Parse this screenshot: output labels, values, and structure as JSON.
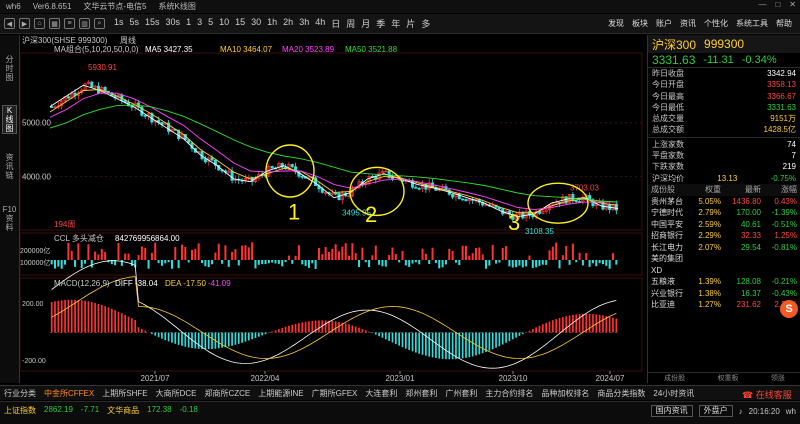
{
  "titlebar": {
    "app": "wh6",
    "version": "Ver6.8.651",
    "server": "文华云节点-电信5",
    "view": "系统K线图",
    "controls": [
      "—",
      "□",
      "✕"
    ]
  },
  "toolbar": {
    "periods": [
      "1s",
      "5s",
      "15s",
      "30s",
      "1",
      "3",
      "5",
      "10",
      "15",
      "30",
      "1h",
      "2h",
      "3h",
      "4h",
      "日",
      "周",
      "月",
      "季",
      "年",
      "片",
      "多"
    ],
    "right": [
      "发现",
      "板块",
      "账户",
      "资讯",
      "个性化",
      "系统工具",
      "帮助"
    ]
  },
  "left_tabs": [
    {
      "label": "分时图",
      "active": false
    },
    {
      "label": "K线图",
      "active": true
    },
    {
      "label": "资讯链",
      "active": false
    },
    {
      "label": "F10资料",
      "active": false
    }
  ],
  "chart_header": {
    "symbol": "沪深300(SHSE 999300)",
    "period": "周线",
    "ma_label": "MA组合(5,10,20,50,0,0)",
    "ma5": "MA5 3427.35",
    "ma10": "MA10 3464.07",
    "ma20": "MA20 3523.89",
    "ma50": "MA50 3521.88"
  },
  "chart_data": [
    {
      "type": "candlestick",
      "title": "沪深300(SHSE 999300) 周线",
      "x_ticks": [
        "2021/07",
        "2022/04",
        "2023/01",
        "2023/10",
        "2024/07"
      ],
      "y_ticks": [
        "5000.00",
        "4000.00"
      ],
      "ylim": [
        3000,
        6300
      ],
      "annotations": {
        "high_label": "5930.91",
        "low_label_1": "3495.95",
        "low_label_2": "3108.35",
        "recent_high_label": "3703.03",
        "count_label": "194周",
        "handwritten": [
          "1",
          "2",
          "3"
        ]
      },
      "series": [
        {
          "name": "MA5",
          "values": [
            5300,
            5500,
            5700,
            5600,
            5450,
            5300,
            5100,
            4900,
            4700,
            4400,
            4200,
            3950,
            3900,
            4100,
            4200,
            4050,
            3850,
            3600,
            3700,
            3950,
            4050,
            3950,
            3850,
            3780,
            3700,
            3600,
            3500,
            3350,
            3250,
            3300,
            3500,
            3580,
            3600,
            3450,
            3400
          ]
        },
        {
          "name": "MA10",
          "values": [
            5200,
            5400,
            5600,
            5620,
            5500,
            5350,
            5180,
            4980,
            4780,
            4500,
            4300,
            4080,
            3950,
            4050,
            4150,
            4100,
            3920,
            3700,
            3720,
            3900,
            4000,
            3970,
            3880,
            3800,
            3720,
            3640,
            3540,
            3420,
            3320,
            3320,
            3450,
            3540,
            3580,
            3500,
            3460
          ]
        },
        {
          "name": "MA20",
          "values": [
            5100,
            5250,
            5450,
            5550,
            5550,
            5450,
            5300,
            5120,
            4950,
            4700,
            4480,
            4250,
            4100,
            4080,
            4100,
            4100,
            4000,
            3850,
            3780,
            3860,
            3930,
            3950,
            3900,
            3840,
            3770,
            3700,
            3620,
            3520,
            3420,
            3380,
            3420,
            3480,
            3520,
            3520,
            3520
          ]
        },
        {
          "name": "MA50",
          "values": [
            4900,
            5000,
            5150,
            5250,
            5320,
            5330,
            5300,
            5220,
            5120,
            4980,
            4830,
            4680,
            4550,
            4450,
            4380,
            4330,
            4260,
            4170,
            4080,
            4050,
            4030,
            4010,
            3990,
            3960,
            3920,
            3880,
            3830,
            3760,
            3690,
            3640,
            3620,
            3600,
            3570,
            3540,
            3520
          ]
        }
      ]
    },
    {
      "type": "bar",
      "title": "CCL 多头减仓",
      "value_label": "842769956864.00",
      "y_ticks": [
        "200000亿",
        "100000亿"
      ]
    },
    {
      "type": "line",
      "title": "MACD(12,26,9)",
      "diff_label": "DIFF -38.04",
      "dea_label": "DEA -17.50",
      "macd_label": "-41.09",
      "y_ticks": [
        "200.00",
        "-200.00"
      ]
    }
  ],
  "right_panel": {
    "name": "沪深300",
    "code": "999300",
    "price": "3331.63",
    "change": "-11.31",
    "change_pct": "-0.34%",
    "stats": [
      {
        "label": "昨日收盘",
        "value": "3342.94",
        "color": "#ffffff"
      },
      {
        "label": "今日开盘",
        "value": "3358.13",
        "color": "#ff4444"
      },
      {
        "label": "今日最高",
        "value": "3366.67",
        "color": "#ff4444"
      },
      {
        "label": "今日最低",
        "value": "3331.63",
        "color": "#2ecc40"
      },
      {
        "label": "总成交量",
        "value": "9151万",
        "color": "#ffcc33"
      },
      {
        "label": "总成交额",
        "value": "1428.5亿",
        "color": "#ffcc33"
      }
    ],
    "breadth": [
      {
        "label": "上涨家数",
        "value": "74",
        "color": "#ffffff"
      },
      {
        "label": "平盘家数",
        "value": "7",
        "color": "#ffffff"
      },
      {
        "label": "下跌家数",
        "value": "219",
        "color": "#ffffff"
      }
    ],
    "avg": {
      "label": "沪深均价",
      "value": "13.13",
      "pct": "-0.75%"
    },
    "constituents_headers": [
      "成份股",
      "权重",
      "最新",
      "涨幅"
    ],
    "constituents": [
      {
        "name": "贵州茅台",
        "weight": "5.05%",
        "last": "1436.80",
        "chg": "0.43%",
        "up": true
      },
      {
        "name": "宁德时代",
        "weight": "2.79%",
        "last": "170.00",
        "chg": "-1.39%",
        "up": false
      },
      {
        "name": "中国平安",
        "weight": "2.59%",
        "last": "40.61",
        "chg": "-0.51%",
        "up": false
      },
      {
        "name": "招商银行",
        "weight": "2.29%",
        "last": "32.33",
        "chg": "1.25%",
        "up": true
      },
      {
        "name": "长江电力",
        "weight": "2.07%",
        "last": "29.54",
        "chg": "-0.81%",
        "up": false
      },
      {
        "name": "美的集团",
        "weight": "",
        "last": "",
        "chg": "",
        "up": true
      },
      {
        "name": "XD",
        "weight": "",
        "last": "",
        "chg": "",
        "up": false
      },
      {
        "name": "五粮液",
        "weight": "1.39%",
        "last": "128.08",
        "chg": "-0.21%",
        "up": false
      },
      {
        "name": "兴业银行",
        "weight": "1.38%",
        "last": "16.37",
        "chg": "-0.43%",
        "up": false
      },
      {
        "name": "比亚迪",
        "weight": "1.27%",
        "last": "231.62",
        "chg": "2.28%",
        "up": true
      }
    ],
    "tabs": [
      "成份股",
      "权重板",
      "领涨"
    ]
  },
  "bottom_tabs": [
    "行业分类",
    "中金所CFFEX",
    "上期所SHFE",
    "大商所DCE",
    "郑商所CZCE",
    "上期能源INE",
    "广期所GFEX",
    "大连套利",
    "郑州套利",
    "广州套利",
    "主力合约排名",
    "品种加权排名",
    "商品分类指数",
    "24小时资讯"
  ],
  "bottom_active": 1,
  "status": {
    "sh_label": "上证指数",
    "sh_value": "2862.19",
    "sh_change": "-7.71",
    "wh_label": "文华商品",
    "wh_value": "172.38",
    "wh_change": "-0.18",
    "btn_domestic": "国内资讯",
    "btn_foreign": "外盘户",
    "time": "20:16:20",
    "day": "wh",
    "online": "在线客服"
  }
}
